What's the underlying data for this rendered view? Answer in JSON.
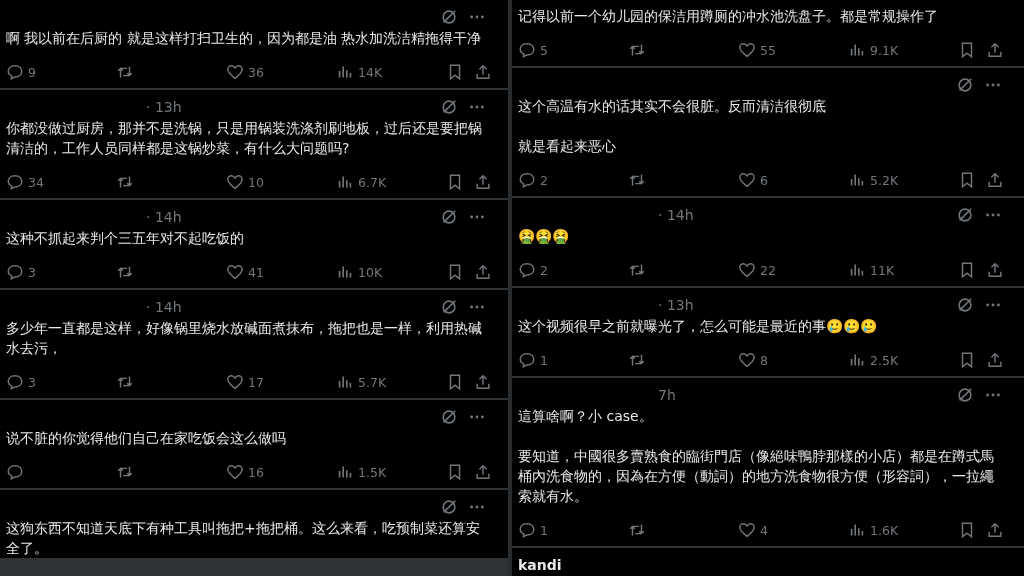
{
  "columns": [
    {
      "posts": [
        {
          "header_icons": true,
          "paragraphs": [
            {
              "text": "啊 我以前在后厨的 就是这样打扫卫生的，因为都是油 热水加洗洁精拖得干净"
            }
          ],
          "actions": {
            "replies": "9",
            "likes": "36",
            "views": "14K"
          }
        },
        {
          "header_icons": true,
          "time": "· 13h",
          "paragraphs": [
            {
              "text": "你都没做过厨房，那并不是洗锅，只是用锅装洗涤剂刷地板，过后还是要把锅清洁的，工作人员同样都是这锅炒菜，有什么大问题吗?"
            }
          ],
          "actions": {
            "replies": "34",
            "likes": "10",
            "views": "6.7K"
          }
        },
        {
          "header_icons": true,
          "time": "· 14h",
          "paragraphs": [
            {
              "text": "这种不抓起来判个三五年对不起吃饭的"
            }
          ],
          "actions": {
            "replies": "3",
            "likes": "41",
            "views": "10K"
          }
        },
        {
          "header_icons": true,
          "time": "· 14h",
          "paragraphs": [
            {
              "text": "多少年一直都是这样，好像锅里烧水放碱面煮抹布，拖把也是一样，利用热碱水去污，"
            }
          ],
          "actions": {
            "replies": "3",
            "likes": "17",
            "views": "5.7K"
          }
        },
        {
          "header_icons": true,
          "paragraphs": [
            {
              "text": "说不脏的你觉得他们自己在家吃饭会这么做吗"
            }
          ],
          "actions": {
            "likes": "16",
            "views": "1.5K"
          }
        },
        {
          "header_icons": true,
          "paragraphs": [
            {
              "text": "这狗东西不知道天底下有种工具叫拖把+拖把桶。这么来看，吃预制菜还算安全了。"
            }
          ]
        }
      ]
    },
    {
      "posts": [
        {
          "header_icons": false,
          "paragraphs": [
            {
              "text": "记得以前一个幼儿园的保洁用蹲厕的冲水池洗盘子。都是常规操作了"
            }
          ],
          "actions": {
            "replies": "5",
            "likes": "55",
            "views": "9.1K"
          }
        },
        {
          "header_icons": true,
          "paragraphs": [
            {
              "text": "这个高温有水的话其实不会很脏。反而清洁很彻底"
            },
            {
              "text": "就是看起来恶心"
            }
          ],
          "actions": {
            "replies": "2",
            "likes": "6",
            "views": "5.2K"
          }
        },
        {
          "header_icons": true,
          "time": "· 14h",
          "paragraphs": [
            {
              "text": "🤮🤮🤮"
            }
          ],
          "actions": {
            "replies": "2",
            "likes": "22",
            "views": "11K"
          }
        },
        {
          "header_icons": true,
          "time": "· 13h",
          "paragraphs": [
            {
              "text": "这个视频很早之前就曝光了，怎么可能是最近的事🥲🥲🥲"
            }
          ],
          "actions": {
            "replies": "1",
            "likes": "8",
            "views": "2.5K"
          }
        },
        {
          "header_icons": true,
          "time": "7h",
          "paragraphs": [
            {
              "text": "這算啥啊？小 case。"
            },
            {
              "text": "要知道，中國很多賣熟食的臨街門店（像絕味鴨脖那樣的小店）都是在蹲式馬桶內洗食物的，因為在方便（動詞）的地方洗食物很方便（形容詞），一拉繩索就有水。"
            }
          ],
          "actions": {
            "replies": "1",
            "likes": "4",
            "views": "1.6K"
          }
        },
        {
          "header_icons": false,
          "name": "kandi"
        }
      ]
    }
  ]
}
